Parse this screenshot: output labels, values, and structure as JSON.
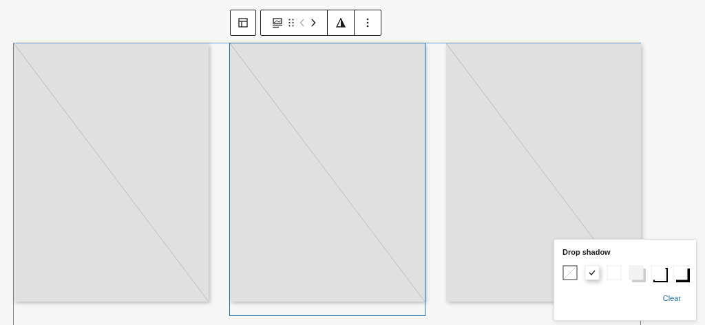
{
  "gallery": {
    "images": [
      {
        "kind": "placeholder",
        "selected": false
      },
      {
        "kind": "placeholder",
        "selected": true
      },
      {
        "kind": "placeholder",
        "selected": false
      }
    ]
  },
  "popover": {
    "title": "Drop shadow",
    "options": [
      {
        "kind": "none",
        "selected": false
      },
      {
        "kind": "natural",
        "selected": true
      },
      {
        "kind": "deep",
        "selected": false
      },
      {
        "kind": "sharp",
        "selected": false
      },
      {
        "kind": "outlined",
        "selected": false
      },
      {
        "kind": "crisp",
        "selected": false
      }
    ],
    "clear_label": "Clear"
  }
}
